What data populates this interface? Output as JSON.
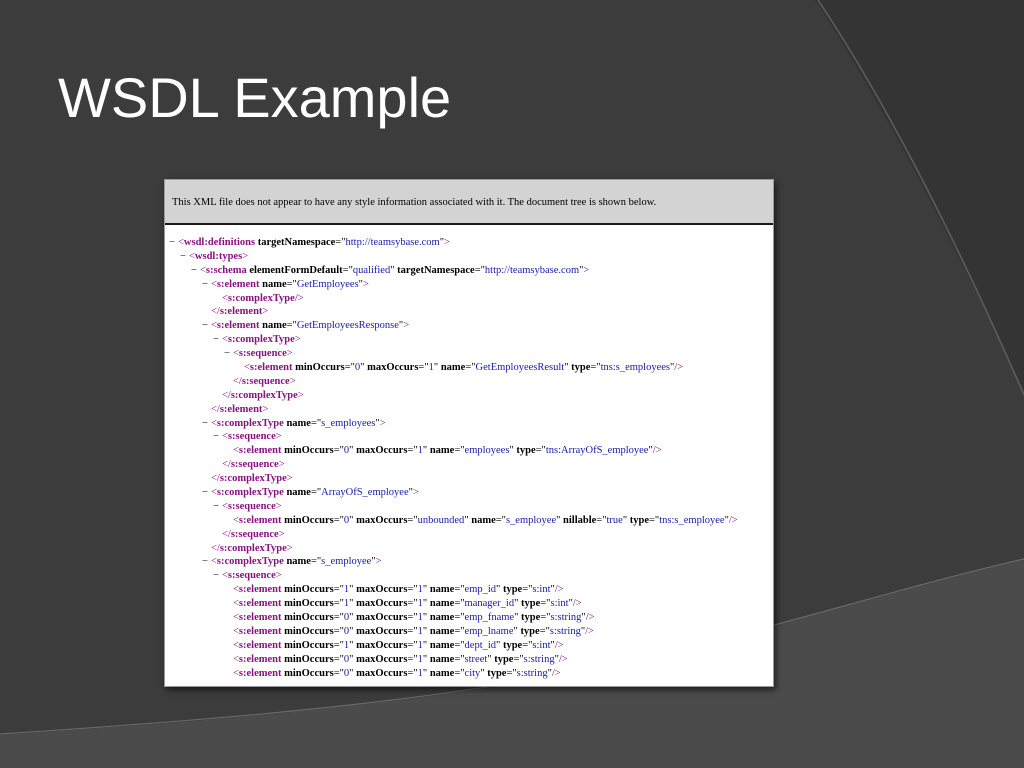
{
  "slide": {
    "title": "WSDL Example"
  },
  "browser": {
    "notice": "This XML file does not appear to have any style information associated with it. The document tree is shown below."
  },
  "colors": {
    "slide_background": "#3b3b3b",
    "title_text": "#ffffff",
    "xml_tag": "#881280",
    "xml_attribute_value": "#1a1aa6",
    "notice_background": "#d3d3d3"
  },
  "xml_lines": [
    {
      "depth": 0,
      "toggle": "−",
      "kind": "open",
      "tag": "wsdl:definitions",
      "attrs": [
        [
          "targetNamespace",
          "http://teamsybase.com"
        ]
      ]
    },
    {
      "depth": 1,
      "toggle": "−",
      "kind": "open",
      "tag": "wsdl:types",
      "attrs": []
    },
    {
      "depth": 2,
      "toggle": "−",
      "kind": "open",
      "tag": "s:schema",
      "attrs": [
        [
          "elementFormDefault",
          "qualified"
        ],
        [
          "targetNamespace",
          "http://teamsybase.com"
        ]
      ]
    },
    {
      "depth": 3,
      "toggle": "−",
      "kind": "open",
      "tag": "s:element",
      "attrs": [
        [
          "name",
          "GetEmployees"
        ]
      ]
    },
    {
      "depth": 4,
      "toggle": "",
      "kind": "empty",
      "tag": "s:complexType",
      "attrs": []
    },
    {
      "depth": 3,
      "toggle": "",
      "kind": "close",
      "tag": "s:element",
      "attrs": []
    },
    {
      "depth": 3,
      "toggle": "−",
      "kind": "open",
      "tag": "s:element",
      "attrs": [
        [
          "name",
          "GetEmployeesResponse"
        ]
      ]
    },
    {
      "depth": 4,
      "toggle": "−",
      "kind": "open",
      "tag": "s:complexType",
      "attrs": []
    },
    {
      "depth": 5,
      "toggle": "−",
      "kind": "open",
      "tag": "s:sequence",
      "attrs": []
    },
    {
      "depth": 6,
      "toggle": "",
      "kind": "empty",
      "tag": "s:element",
      "attrs": [
        [
          "minOccurs",
          "0"
        ],
        [
          "maxOccurs",
          "1"
        ],
        [
          "name",
          "GetEmployeesResult"
        ],
        [
          "type",
          "tns:s_employees"
        ]
      ]
    },
    {
      "depth": 5,
      "toggle": "",
      "kind": "close",
      "tag": "s:sequence",
      "attrs": []
    },
    {
      "depth": 4,
      "toggle": "",
      "kind": "close",
      "tag": "s:complexType",
      "attrs": []
    },
    {
      "depth": 3,
      "toggle": "",
      "kind": "close",
      "tag": "s:element",
      "attrs": []
    },
    {
      "depth": 3,
      "toggle": "−",
      "kind": "open",
      "tag": "s:complexType",
      "attrs": [
        [
          "name",
          "s_employees"
        ]
      ]
    },
    {
      "depth": 4,
      "toggle": "−",
      "kind": "open",
      "tag": "s:sequence",
      "attrs": []
    },
    {
      "depth": 5,
      "toggle": "",
      "kind": "empty",
      "tag": "s:element",
      "attrs": [
        [
          "minOccurs",
          "0"
        ],
        [
          "maxOccurs",
          "1"
        ],
        [
          "name",
          "employees"
        ],
        [
          "type",
          "tns:ArrayOfS_employee"
        ]
      ]
    },
    {
      "depth": 4,
      "toggle": "",
      "kind": "close",
      "tag": "s:sequence",
      "attrs": []
    },
    {
      "depth": 3,
      "toggle": "",
      "kind": "close",
      "tag": "s:complexType",
      "attrs": []
    },
    {
      "depth": 3,
      "toggle": "−",
      "kind": "open",
      "tag": "s:complexType",
      "attrs": [
        [
          "name",
          "ArrayOfS_employee"
        ]
      ]
    },
    {
      "depth": 4,
      "toggle": "−",
      "kind": "open",
      "tag": "s:sequence",
      "attrs": []
    },
    {
      "depth": 5,
      "toggle": "",
      "kind": "empty",
      "tag": "s:element",
      "attrs": [
        [
          "minOccurs",
          "0"
        ],
        [
          "maxOccurs",
          "unbounded"
        ],
        [
          "name",
          "s_employee"
        ],
        [
          "nillable",
          "true"
        ],
        [
          "type",
          "tns:s_employee"
        ]
      ]
    },
    {
      "depth": 4,
      "toggle": "",
      "kind": "close",
      "tag": "s:sequence",
      "attrs": []
    },
    {
      "depth": 3,
      "toggle": "",
      "kind": "close",
      "tag": "s:complexType",
      "attrs": []
    },
    {
      "depth": 3,
      "toggle": "−",
      "kind": "open",
      "tag": "s:complexType",
      "attrs": [
        [
          "name",
          "s_employee"
        ]
      ]
    },
    {
      "depth": 4,
      "toggle": "−",
      "kind": "open",
      "tag": "s:sequence",
      "attrs": []
    },
    {
      "depth": 5,
      "toggle": "",
      "kind": "empty",
      "tag": "s:element",
      "attrs": [
        [
          "minOccurs",
          "1"
        ],
        [
          "maxOccurs",
          "1"
        ],
        [
          "name",
          "emp_id"
        ],
        [
          "type",
          "s:int"
        ]
      ]
    },
    {
      "depth": 5,
      "toggle": "",
      "kind": "empty",
      "tag": "s:element",
      "attrs": [
        [
          "minOccurs",
          "1"
        ],
        [
          "maxOccurs",
          "1"
        ],
        [
          "name",
          "manager_id"
        ],
        [
          "type",
          "s:int"
        ]
      ]
    },
    {
      "depth": 5,
      "toggle": "",
      "kind": "empty",
      "tag": "s:element",
      "attrs": [
        [
          "minOccurs",
          "0"
        ],
        [
          "maxOccurs",
          "1"
        ],
        [
          "name",
          "emp_fname"
        ],
        [
          "type",
          "s:string"
        ]
      ]
    },
    {
      "depth": 5,
      "toggle": "",
      "kind": "empty",
      "tag": "s:element",
      "attrs": [
        [
          "minOccurs",
          "0"
        ],
        [
          "maxOccurs",
          "1"
        ],
        [
          "name",
          "emp_lname"
        ],
        [
          "type",
          "s:string"
        ]
      ]
    },
    {
      "depth": 5,
      "toggle": "",
      "kind": "empty",
      "tag": "s:element",
      "attrs": [
        [
          "minOccurs",
          "1"
        ],
        [
          "maxOccurs",
          "1"
        ],
        [
          "name",
          "dept_id"
        ],
        [
          "type",
          "s:int"
        ]
      ]
    },
    {
      "depth": 5,
      "toggle": "",
      "kind": "empty",
      "tag": "s:element",
      "attrs": [
        [
          "minOccurs",
          "0"
        ],
        [
          "maxOccurs",
          "1"
        ],
        [
          "name",
          "street"
        ],
        [
          "type",
          "s:string"
        ]
      ]
    },
    {
      "depth": 5,
      "toggle": "",
      "kind": "empty",
      "tag": "s:element",
      "attrs": [
        [
          "minOccurs",
          "0"
        ],
        [
          "maxOccurs",
          "1"
        ],
        [
          "name",
          "city"
        ],
        [
          "type",
          "s:string"
        ]
      ]
    }
  ]
}
